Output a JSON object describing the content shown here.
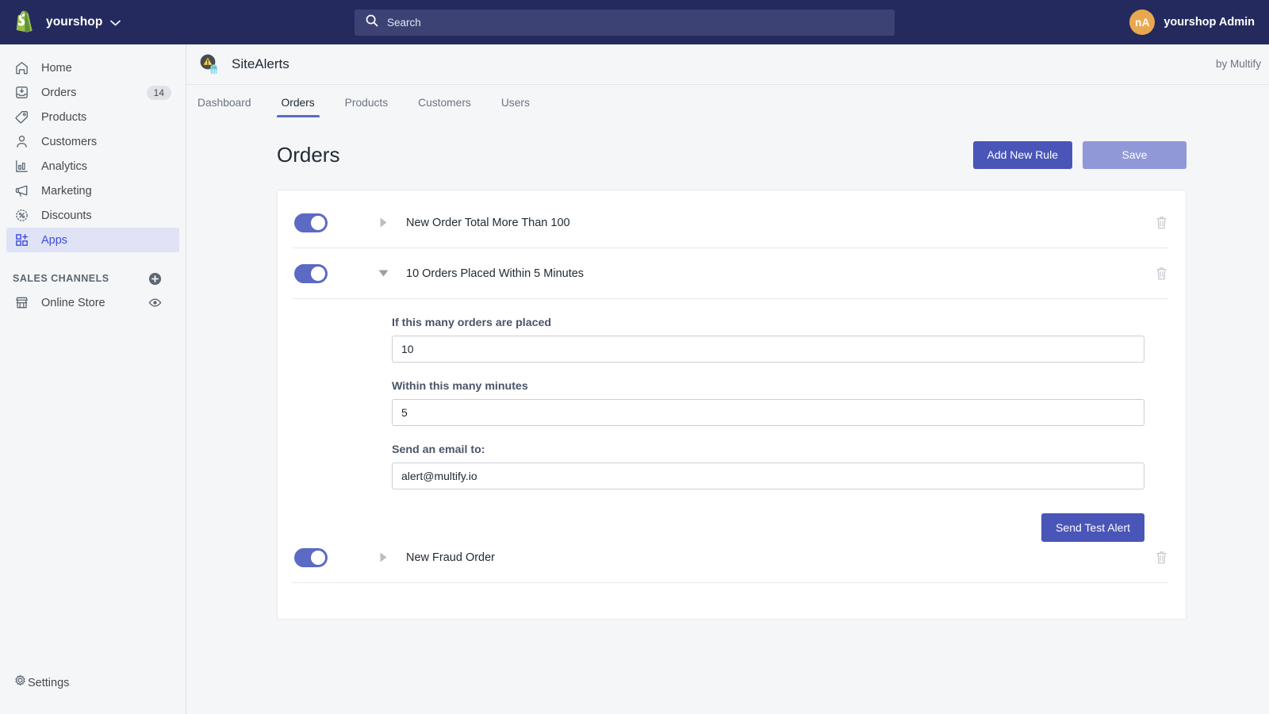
{
  "topbar": {
    "shop_name": "yourshop",
    "shop_caret_icon": "chevron-down-icon",
    "shop_logo_icon": "shopify-bag-icon",
    "search": {
      "placeholder": "Search",
      "value": "",
      "icon": "search-icon"
    },
    "user": {
      "initials": "nA",
      "name": "yourshop Admin",
      "avatar_color": "#e9a84f"
    }
  },
  "sidebar": {
    "items": [
      {
        "label": "Home",
        "icon": "home-icon",
        "badge": "",
        "active": false
      },
      {
        "label": "Orders",
        "icon": "orders-icon",
        "badge": "14",
        "active": false
      },
      {
        "label": "Products",
        "icon": "tag-icon",
        "badge": "",
        "active": false
      },
      {
        "label": "Customers",
        "icon": "person-icon",
        "badge": "",
        "active": false
      },
      {
        "label": "Analytics",
        "icon": "bar-chart-icon",
        "badge": "",
        "active": false
      },
      {
        "label": "Marketing",
        "icon": "megaphone-icon",
        "badge": "",
        "active": false
      },
      {
        "label": "Discounts",
        "icon": "discount-icon",
        "badge": "",
        "active": false
      },
      {
        "label": "Apps",
        "icon": "apps-icon",
        "badge": "",
        "active": true
      }
    ],
    "sales_channels": {
      "title": "SALES CHANNELS",
      "add_icon": "plus-circle-icon",
      "channels": [
        {
          "label": "Online Store",
          "icon": "storefront-icon",
          "action_icon": "eye-icon"
        }
      ]
    },
    "settings": {
      "label": "Settings",
      "icon": "gear-icon"
    }
  },
  "app": {
    "name": "SiteAlerts",
    "logo_icon": "sitealerts-warning-jellyfish-icon",
    "by_line": "by Multify",
    "tabs": [
      {
        "label": "Dashboard",
        "active": false
      },
      {
        "label": "Orders",
        "active": true
      },
      {
        "label": "Products",
        "active": false
      },
      {
        "label": "Customers",
        "active": false
      },
      {
        "label": "Users",
        "active": false
      }
    ]
  },
  "page": {
    "title": "Orders",
    "add_rule_label": "Add New Rule",
    "save_label": "Save",
    "accent_color": "#4a55b8",
    "muted_color": "#9198d8"
  },
  "rules": [
    {
      "name": "New Order Total More Than 100",
      "enabled": true,
      "expanded": false,
      "caret_icon": "caret-right-icon",
      "delete_icon": "trash-icon"
    },
    {
      "name": "10 Orders Placed Within 5 Minutes",
      "enabled": true,
      "expanded": true,
      "caret_icon": "caret-down-icon",
      "delete_icon": "trash-icon",
      "fields": [
        {
          "label": "If this many orders are placed",
          "value": "10",
          "placeholder": ""
        },
        {
          "label": "Within this many minutes",
          "value": "5",
          "placeholder": ""
        },
        {
          "label": "Send an email to:",
          "value": "alert@multify.io",
          "placeholder": ""
        }
      ],
      "test_button_label": "Send Test Alert"
    },
    {
      "name": "New Fraud Order",
      "enabled": true,
      "expanded": false,
      "caret_icon": "caret-right-icon",
      "delete_icon": "trash-icon"
    }
  ]
}
